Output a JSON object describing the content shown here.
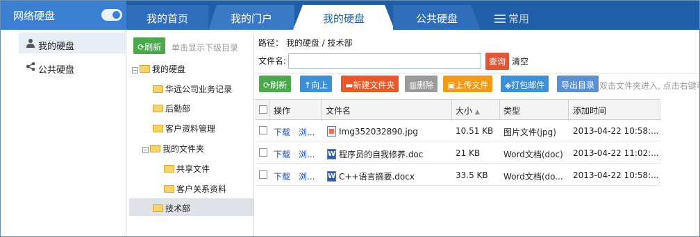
{
  "app": {
    "brand": "网络硬盘"
  },
  "tabs": [
    {
      "label": "我的首页"
    },
    {
      "label": "我的门户"
    },
    {
      "label": "我的硬盘"
    },
    {
      "label": "公共硬盘"
    },
    {
      "label": "常用"
    }
  ],
  "sidebar": {
    "items": [
      {
        "label": "我的硬盘"
      },
      {
        "label": "公共硬盘"
      }
    ]
  },
  "tree": {
    "refresh_label": "刷新",
    "hint": "单击显示下级目录",
    "nodes": [
      {
        "label": "我的硬盘",
        "expander": "−"
      },
      {
        "label": "华远公司业务记录"
      },
      {
        "label": "后勤部"
      },
      {
        "label": "客户资料管理"
      },
      {
        "label": "我的文件夹",
        "expander": "−"
      },
      {
        "label": "共享文件"
      },
      {
        "label": "客户关系资料"
      },
      {
        "label": "技术部"
      }
    ]
  },
  "main": {
    "path": "路径： 我的硬盘 / 技术部",
    "filename_label": "文件名:",
    "filename_value": "",
    "search_label": "查询",
    "clear_label": "清空",
    "toolbar": {
      "refresh": "刷新",
      "up": "向上",
      "new_folder": "新建文件夹",
      "delete": "删除",
      "upload": "上传文件",
      "pack_mail": "打包邮件",
      "export": "导出目录",
      "hint": "双击文件夹进入, 点击右键可"
    },
    "columns": {
      "op": "操作",
      "name": "文件名",
      "size": "大小",
      "type": "类型",
      "time": "添加时间"
    },
    "rows": [
      {
        "download": "下载",
        "browse": "浏...",
        "name": "Img352032890.jpg",
        "icon": "image-file-icon",
        "size": "10.51 KB",
        "type": "图片文件(jpg)",
        "time": "2013-04-22 10:58:..."
      },
      {
        "download": "下载",
        "browse": "浏...",
        "name": "程序员的自我修养.doc",
        "icon": "word-file-icon",
        "size": "21 KB",
        "type": "Word文档(doc)",
        "time": "2013-04-22 11:02:..."
      },
      {
        "download": "下载",
        "browse": "浏...",
        "name": "C++语言摘要.docx",
        "icon": "word-file-icon",
        "size": "33.5 KB",
        "type": "Word文档(do...",
        "time": "2013-04-22 10:58:..."
      }
    ]
  },
  "colors": {
    "topbar": "#1f5fa8",
    "brand_bg": "#3b7fd0",
    "green": "#4ca84c",
    "orange": "#f19a1a",
    "red": "#e8582b",
    "blue": "#3d8fd6"
  }
}
